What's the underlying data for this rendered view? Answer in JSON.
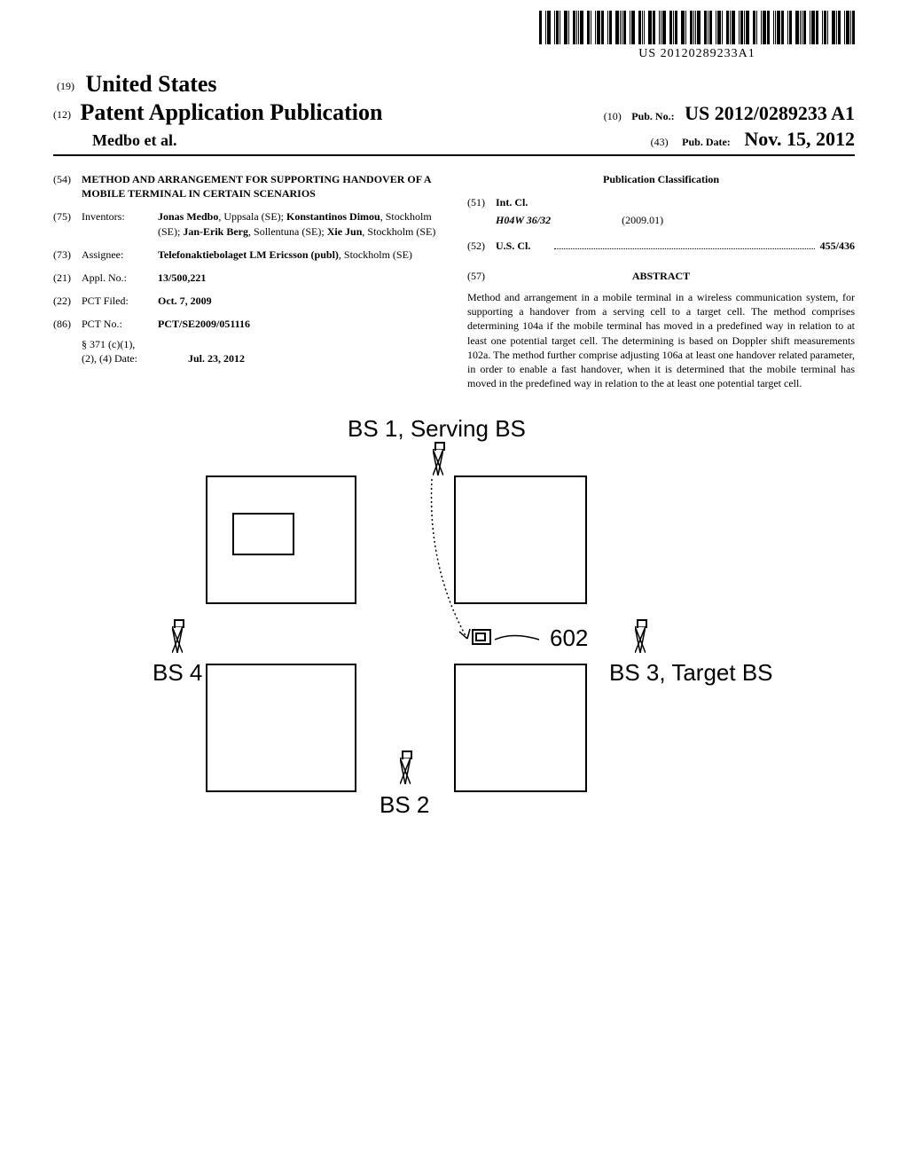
{
  "barcode_text": "US 20120289233A1",
  "country_prefix": "(19)",
  "country": "United States",
  "pubkind_prefix": "(12)",
  "pubkind": "Patent Application Publication",
  "authors_line": "Medbo et al.",
  "pub_no_prefix": "(10)",
  "pub_no_label": "Pub. No.:",
  "pub_no_value": "US 2012/0289233 A1",
  "pub_date_prefix": "(43)",
  "pub_date_label": "Pub. Date:",
  "pub_date_value": "Nov. 15, 2012",
  "left_col": {
    "title": {
      "inid": "(54)",
      "value": "METHOD AND ARRANGEMENT FOR SUPPORTING HANDOVER OF A MOBILE TERMINAL IN CERTAIN SCENARIOS"
    },
    "inventors": {
      "inid": "(75)",
      "label": "Inventors:",
      "text_html": "Jonas Medbo, Uppsala (SE); Konstantinos Dimou, Stockholm (SE); Jan-Erik Berg, Sollentuna (SE); Xie Jun, Stockholm (SE)",
      "parts": [
        {
          "name": "Jonas Medbo",
          "loc": ", Uppsala (SE); "
        },
        {
          "name": "Konstantinos Dimou",
          "loc": ", Stockholm (SE); "
        },
        {
          "name": "Jan-Erik Berg",
          "loc": ", Sollentuna (SE); "
        },
        {
          "name": "Xie Jun",
          "loc": ", Stockholm (SE)"
        }
      ]
    },
    "assignee": {
      "inid": "(73)",
      "label": "Assignee:",
      "name": "Telefonaktiebolaget LM Ericsson (publ)",
      "loc": ", Stockholm (SE)"
    },
    "appl_no": {
      "inid": "(21)",
      "label": "Appl. No.:",
      "value": "13/500,221"
    },
    "pct_filed": {
      "inid": "(22)",
      "label": "PCT Filed:",
      "value": "Oct. 7, 2009"
    },
    "pct_no": {
      "inid": "(86)",
      "label": "PCT No.:",
      "value": "PCT/SE2009/051116"
    },
    "s371": {
      "label1": "§ 371 (c)(1),",
      "label2": "(2), (4) Date:",
      "value": "Jul. 23, 2012"
    }
  },
  "right_col": {
    "classif_heading": "Publication Classification",
    "intcl_inid": "(51)",
    "intcl_label": "Int. Cl.",
    "intcl_code": "H04W 36/32",
    "intcl_ed": "(2009.01)",
    "uscl_inid": "(52)",
    "uscl_label": "U.S. Cl.",
    "uscl_value": "455/436",
    "abstract_inid": "(57)",
    "abstract_heading": "ABSTRACT",
    "abstract_body": "Method and arrangement in a mobile terminal in a wireless communication system, for supporting a handover from a serving cell to a target cell. The method comprises determining 104a if the mobile terminal has moved in a predefined way in relation to at least one potential target cell. The determining is based on Doppler shift measurements 102a. The method further comprise adjusting 106a at least one handover related parameter, in order to enable a fast handover, when it is determined that the mobile terminal has moved in the predefined way in relation to the at least one potential target cell."
  },
  "figure": {
    "top_label": "BS 1, Serving BS",
    "left_label": "BS 4",
    "right_label": "BS 3, Target BS",
    "bottom_label": "BS 2",
    "ref_num": "602"
  }
}
